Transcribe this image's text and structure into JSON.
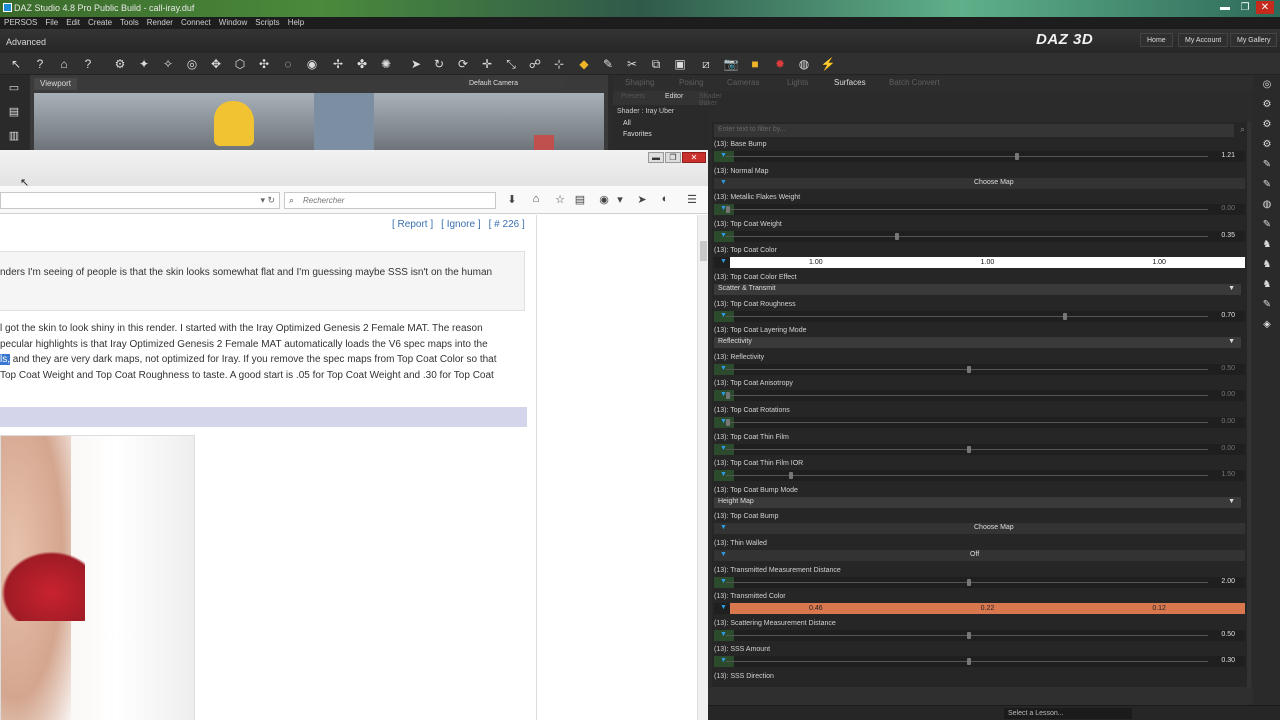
{
  "window": {
    "title": "DAZ Studio 4.8 Pro Public Build - call-iray.duf"
  },
  "menu": [
    "PERSOS",
    "File",
    "Edit",
    "Create",
    "Tools",
    "Render",
    "Connect",
    "Window",
    "Scripts",
    "Help"
  ],
  "header": {
    "mode": "Advanced",
    "logo": "DAZ 3D",
    "buttons": [
      "Home",
      "My Account",
      "My Gallery"
    ]
  },
  "viewport": {
    "tab": "Viewport",
    "camera": "Default Camera"
  },
  "right_tabs": [
    "Shaping",
    "Posing",
    "Cameras",
    "Lights",
    "Surfaces",
    "Batch Convert"
  ],
  "surfaces_panel": {
    "subtabs": [
      "Presets",
      "Editor",
      "Shader Baker"
    ],
    "shader": "Shader : Iray Uber",
    "list": [
      "All",
      "Favorites"
    ],
    "filter_placeholder": "Enter text to filter by..."
  },
  "browser": {
    "search_placeholder": "Rechercher",
    "actions": [
      "[ Report ]",
      "[ Ignore ]",
      "[ # 226 ]"
    ],
    "quote": "nders I'm seeing of people is that the skin looks somewhat flat and I'm guessing maybe SSS isn't on the human",
    "paragraph": {
      "line1": "l got the skin to look shiny in this render. I started with the Iray Optimized Genesis 2 Female MAT. The reason",
      "line2": "pecular highlights is that Iray Optimized Genesis 2 Female MAT automatically loads the V6 spec maps into the",
      "line3_highlight": "ls,",
      "line3_rest": " and they are very dark maps, not optimized for Iray. If you remove the spec maps from Top Coat Color so that",
      "line4": " Top Coat Weight and Top Coat Roughness to taste. A good start is .05 for Top Coat Weight and .30 for Top Coat"
    }
  },
  "properties": [
    {
      "label": "(13): Base Bump",
      "value": "1.21",
      "pos": 0.6
    },
    {
      "label": "(13): Normal Map",
      "button": "Choose Map"
    },
    {
      "label": "(13): Metallic Flakes Weight",
      "value": "0.00",
      "pos": 0.0,
      "dim": true
    },
    {
      "label": "(13): Top Coat Weight",
      "value": "0.35",
      "pos": 0.35
    },
    {
      "label": "(13): Top Coat Color",
      "colors": [
        "1.00",
        "1.00",
        "1.00"
      ],
      "swatch": "#ffffff"
    },
    {
      "label": "(13): Top Coat Color Effect",
      "enum": "Scatter & Transmit"
    },
    {
      "label": "(13): Top Coat Roughness",
      "value": "0.70",
      "pos": 0.7
    },
    {
      "label": "(13): Top Coat Layering Mode",
      "enum": "Reflectivity"
    },
    {
      "label": "(13): Reflectivity",
      "value": "0.50",
      "pos": 0.5,
      "dim": true
    },
    {
      "label": "(13): Top Coat Anisotropy",
      "value": "0.00",
      "pos": 0.0,
      "dim": true
    },
    {
      "label": "(13): Top Coat Rotations",
      "value": "0.00",
      "pos": 0.0,
      "dim": true
    },
    {
      "label": "(13): Top Coat Thin Film",
      "value": "0.00",
      "pos": 0.5,
      "dim": true
    },
    {
      "label": "(13): Top Coat Thin Film IOR",
      "value": "1.50",
      "pos": 0.13,
      "dim": true
    },
    {
      "label": "(13): Top Coat Bump Mode",
      "enum": "Height Map"
    },
    {
      "label": "(13): Top Coat Bump",
      "button": "Choose Map"
    },
    {
      "label": "(13): Thin Walled",
      "toggle": "Off"
    },
    {
      "label": "(13): Transmitted Measurement Distance",
      "value": "2.00",
      "pos": 0.5
    },
    {
      "label": "(13): Transmitted Color",
      "colors": [
        "0.46",
        "0.22",
        "0.12"
      ],
      "swatch": "#d9784f"
    },
    {
      "label": "(13): Scattering Measurement Distance",
      "value": "0.50",
      "pos": 0.5
    },
    {
      "label": "(13): SSS Amount",
      "value": "0.30",
      "pos": 0.5
    },
    {
      "label": "(13): SSS Direction"
    }
  ],
  "status": {
    "lesson": "Select a Lesson..."
  }
}
